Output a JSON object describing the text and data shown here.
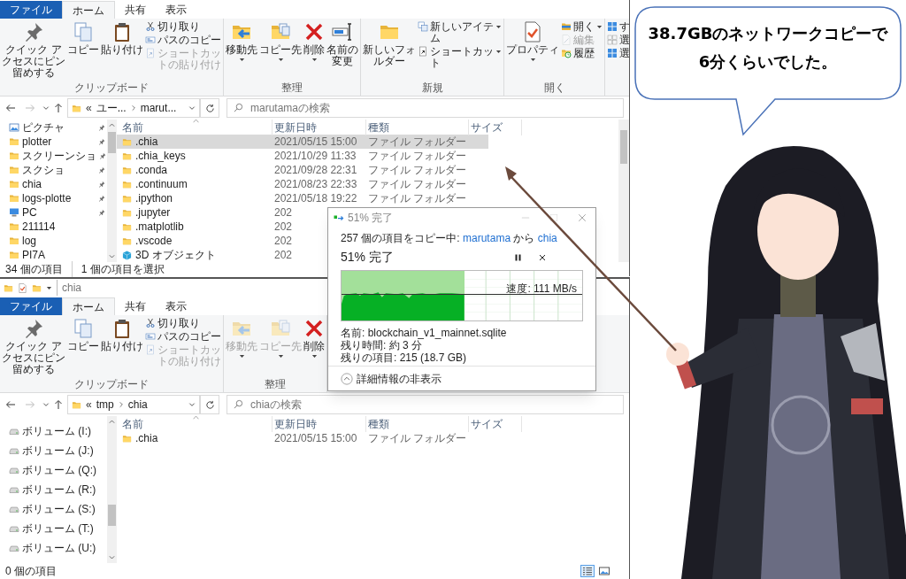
{
  "top_window": {
    "tabs": [
      {
        "label": "ファイル",
        "kind": "file",
        "selected": false
      },
      {
        "label": "ホーム",
        "kind": "tab",
        "selected": true
      },
      {
        "label": "共有",
        "kind": "tab",
        "selected": false
      },
      {
        "label": "表示",
        "kind": "tab",
        "selected": false
      }
    ],
    "ribbon": [
      {
        "label": "クリップボード",
        "items": [
          {
            "kind": "large",
            "label": "クイック アクセスにピン留めする",
            "dropdown": false,
            "disabled": false
          },
          {
            "kind": "large",
            "label": "コピー",
            "dropdown": false,
            "disabled": false
          },
          {
            "kind": "large",
            "label": "貼り付け",
            "dropdown": false,
            "disabled": false
          },
          {
            "kind": "small",
            "label": "切り取り",
            "dropdown": false,
            "disabled": false
          },
          {
            "kind": "small",
            "label": "パスのコピー",
            "dropdown": false,
            "disabled": false
          },
          {
            "kind": "small",
            "label": "ショートカットの貼り付け",
            "dropdown": false,
            "disabled": true
          }
        ]
      },
      {
        "label": "整理",
        "items": [
          {
            "kind": "large",
            "label": "移動先",
            "dropdown": true,
            "disabled": false
          },
          {
            "kind": "large",
            "label": "コピー先",
            "dropdown": true,
            "disabled": false
          },
          {
            "kind": "large",
            "label": "削除",
            "dropdown": true,
            "disabled": false
          },
          {
            "kind": "large",
            "label": "名前の変更",
            "dropdown": false,
            "disabled": false
          }
        ]
      },
      {
        "label": "新規",
        "items": [
          {
            "kind": "large",
            "label": "新しいフォルダー",
            "dropdown": false,
            "disabled": false
          },
          {
            "kind": "small",
            "label": "新しいアイテム",
            "dropdown": true,
            "disabled": false
          },
          {
            "kind": "small",
            "label": "ショートカット",
            "dropdown": true,
            "disabled": false
          }
        ]
      },
      {
        "label": "開く",
        "items": [
          {
            "kind": "large",
            "label": "プロパティ",
            "dropdown": true,
            "disabled": false
          },
          {
            "kind": "small",
            "label": "開く",
            "dropdown": true,
            "disabled": false
          },
          {
            "kind": "small",
            "label": "編集",
            "dropdown": false,
            "disabled": true
          },
          {
            "kind": "small",
            "label": "履歴",
            "dropdown": false,
            "disabled": false
          }
        ]
      },
      {
        "items": [
          {
            "kind": "small",
            "label": "す",
            "dropdown": false,
            "disabled": false
          },
          {
            "kind": "small",
            "label": "選",
            "dropdown": false,
            "disabled": false
          },
          {
            "kind": "small",
            "label": "選",
            "dropdown": false,
            "disabled": false
          }
        ]
      }
    ],
    "address": {
      "overflow": "«",
      "path": [
        "ユー...",
        "marut..."
      ],
      "search_placeholder": "marutamaの検索"
    },
    "columns": [
      "名前",
      "更新日時",
      "種類",
      "サイズ"
    ],
    "nav": [
      {
        "label": "ピクチャ",
        "kind": "pictures",
        "pinned": true
      },
      {
        "label": "plotter",
        "kind": "folder",
        "pinned": true
      },
      {
        "label": "スクリーンショ",
        "kind": "folder",
        "pinned": true
      },
      {
        "label": "スクショ",
        "kind": "folder",
        "pinned": true
      },
      {
        "label": "chia",
        "kind": "folder",
        "pinned": true
      },
      {
        "label": "logs-plotte",
        "kind": "folder",
        "pinned": true
      },
      {
        "label": "PC",
        "kind": "pc",
        "pinned": true
      },
      {
        "label": "211114",
        "kind": "folder",
        "pinned": false
      },
      {
        "label": "log",
        "kind": "folder",
        "pinned": false
      },
      {
        "label": "PI7A",
        "kind": "folder",
        "pinned": false
      }
    ],
    "files": [
      {
        "name": ".chia",
        "kind": "folder",
        "modified": "2021/05/15 15:00",
        "type": "ファイル フォルダー",
        "selected": true
      },
      {
        "name": ".chia_keys",
        "kind": "folder",
        "modified": "2021/10/29 11:33",
        "type": "ファイル フォルダー",
        "selected": false
      },
      {
        "name": ".conda",
        "kind": "folder",
        "modified": "2021/09/28 22:31",
        "type": "ファイル フォルダー",
        "selected": false
      },
      {
        "name": ".continuum",
        "kind": "folder",
        "modified": "2021/08/23 22:33",
        "type": "ファイル フォルダー",
        "selected": false
      },
      {
        "name": ".ipython",
        "kind": "folder",
        "modified": "2021/05/18 19:22",
        "type": "ファイル フォルダー",
        "selected": false
      },
      {
        "name": ".jupyter",
        "kind": "folder",
        "modified": "202",
        "selected": false
      },
      {
        "name": ".matplotlib",
        "kind": "folder",
        "modified": "202",
        "selected": false
      },
      {
        "name": ".vscode",
        "kind": "folder",
        "modified": "202",
        "selected": false
      },
      {
        "name": "3D オブジェクト",
        "kind": "cube",
        "modified": "202",
        "selected": false
      }
    ],
    "status": [
      "34 個の項目",
      "1 個の項目を選択"
    ]
  },
  "bottom_window": {
    "title": "chia",
    "tabs": [
      {
        "label": "ファイル",
        "kind": "file",
        "selected": false
      },
      {
        "label": "ホーム",
        "kind": "tab",
        "selected": true
      },
      {
        "label": "共有",
        "kind": "tab",
        "selected": false
      },
      {
        "label": "表示",
        "kind": "tab",
        "selected": false
      }
    ],
    "ribbon": [
      {
        "label": "クリップボード",
        "items": [
          {
            "kind": "large",
            "label": "クイック アクセスにピン留めする",
            "dropdown": false,
            "disabled": false
          },
          {
            "kind": "large",
            "label": "コピー",
            "dropdown": false,
            "disabled": false
          },
          {
            "kind": "large",
            "label": "貼り付け",
            "dropdown": false,
            "disabled": false
          },
          {
            "kind": "small",
            "label": "切り取り",
            "dropdown": false,
            "disabled": false
          },
          {
            "kind": "small",
            "label": "パスのコピー",
            "dropdown": false,
            "disabled": false
          },
          {
            "kind": "small",
            "label": "ショートカットの貼り付け",
            "dropdown": false,
            "disabled": true
          }
        ]
      },
      {
        "label": "整理",
        "items": [
          {
            "kind": "large",
            "label": "移動先",
            "dropdown": true,
            "disabled": true
          },
          {
            "kind": "large",
            "label": "コピー先",
            "dropdown": true,
            "disabled": true
          },
          {
            "kind": "large",
            "label": "削除",
            "dropdown": true,
            "disabled": false
          }
        ]
      }
    ],
    "address": {
      "overflow": "«",
      "path": [
        "tmp",
        "chia"
      ],
      "search_placeholder": "chiaの検索"
    },
    "columns": [
      "名前",
      "更新日時",
      "種類",
      "サイズ"
    ],
    "nav": [
      {
        "label": "ボリューム (I:)",
        "kind": "drive",
        "pinned": false
      },
      {
        "label": "ボリューム (J:)",
        "kind": "drive",
        "pinned": false
      },
      {
        "label": "ボリューム (Q:)",
        "kind": "drive",
        "pinned": false
      },
      {
        "label": "ボリューム (R:)",
        "kind": "drive",
        "pinned": false
      },
      {
        "label": "ボリューム (S:)",
        "kind": "drive",
        "pinned": false
      },
      {
        "label": "ボリューム (T:)",
        "kind": "drive",
        "pinned": false
      },
      {
        "label": "ボリューム (U:)",
        "kind": "drive",
        "pinned": false
      }
    ],
    "files": [
      {
        "name": ".chia",
        "kind": "folder",
        "modified": "2021/05/15 15:00",
        "type": "ファイル フォルダー",
        "selected": false
      }
    ],
    "status": [
      "0 個の項目"
    ],
    "views": [
      {
        "kind": "details",
        "selected": true
      },
      {
        "kind": "tiles",
        "selected": false
      }
    ]
  },
  "copy_dialog": {
    "title": "51% 完了",
    "copy_line": {
      "prefix": "257 個の項目をコピー中: ",
      "source": "marutama",
      "middle": " から ",
      "destination": "chia"
    },
    "heading": "51% 完了",
    "progress": {
      "level": 0.51
    },
    "speed": "速度: 111 MB/s",
    "details": [
      "名前: blockchain_v1_mainnet.sqlite",
      "残り時間: 約 3 分",
      "残りの項目: 215 (18.7 GB)"
    ],
    "toggle": "詳細情報の非表示"
  },
  "speech_bubble": {
    "lines": [
      "38.7GBのネットワークコピーで",
      "6分くらいでした。"
    ]
  }
}
